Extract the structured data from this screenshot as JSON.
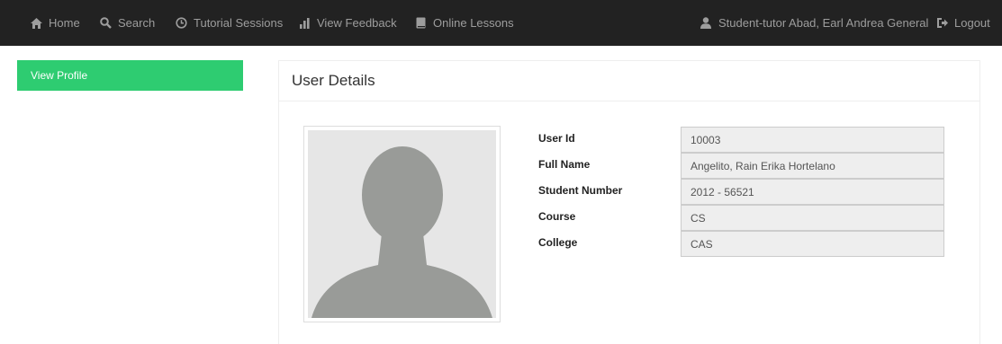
{
  "navbar": {
    "items": [
      {
        "label": "Home",
        "icon": "home-icon"
      },
      {
        "label": "Search",
        "icon": "search-icon"
      },
      {
        "label": "Tutorial Sessions",
        "icon": "clock-icon"
      },
      {
        "label": "View Feedback",
        "icon": "bar-chart-icon"
      },
      {
        "label": "Online Lessons",
        "icon": "book-icon"
      }
    ],
    "user_label": "Student-tutor Abad, Earl Andrea General",
    "user_icon": "user-icon",
    "logout_label": "Logout",
    "logout_icon": "logout-icon"
  },
  "sidebar": {
    "view_profile_label": "View Profile"
  },
  "panel": {
    "title": "User Details"
  },
  "details": {
    "labels": [
      "User Id",
      "Full Name",
      "Student Number",
      "Course",
      "College"
    ],
    "values": [
      "10003",
      "Angelito, Rain Erika Hortelano",
      "2012 - 56521",
      "CS",
      "CAS"
    ]
  },
  "colors": {
    "navbar_bg": "#222222",
    "nav_text": "#9d9d9d",
    "accent_green": "#2ecc71"
  }
}
